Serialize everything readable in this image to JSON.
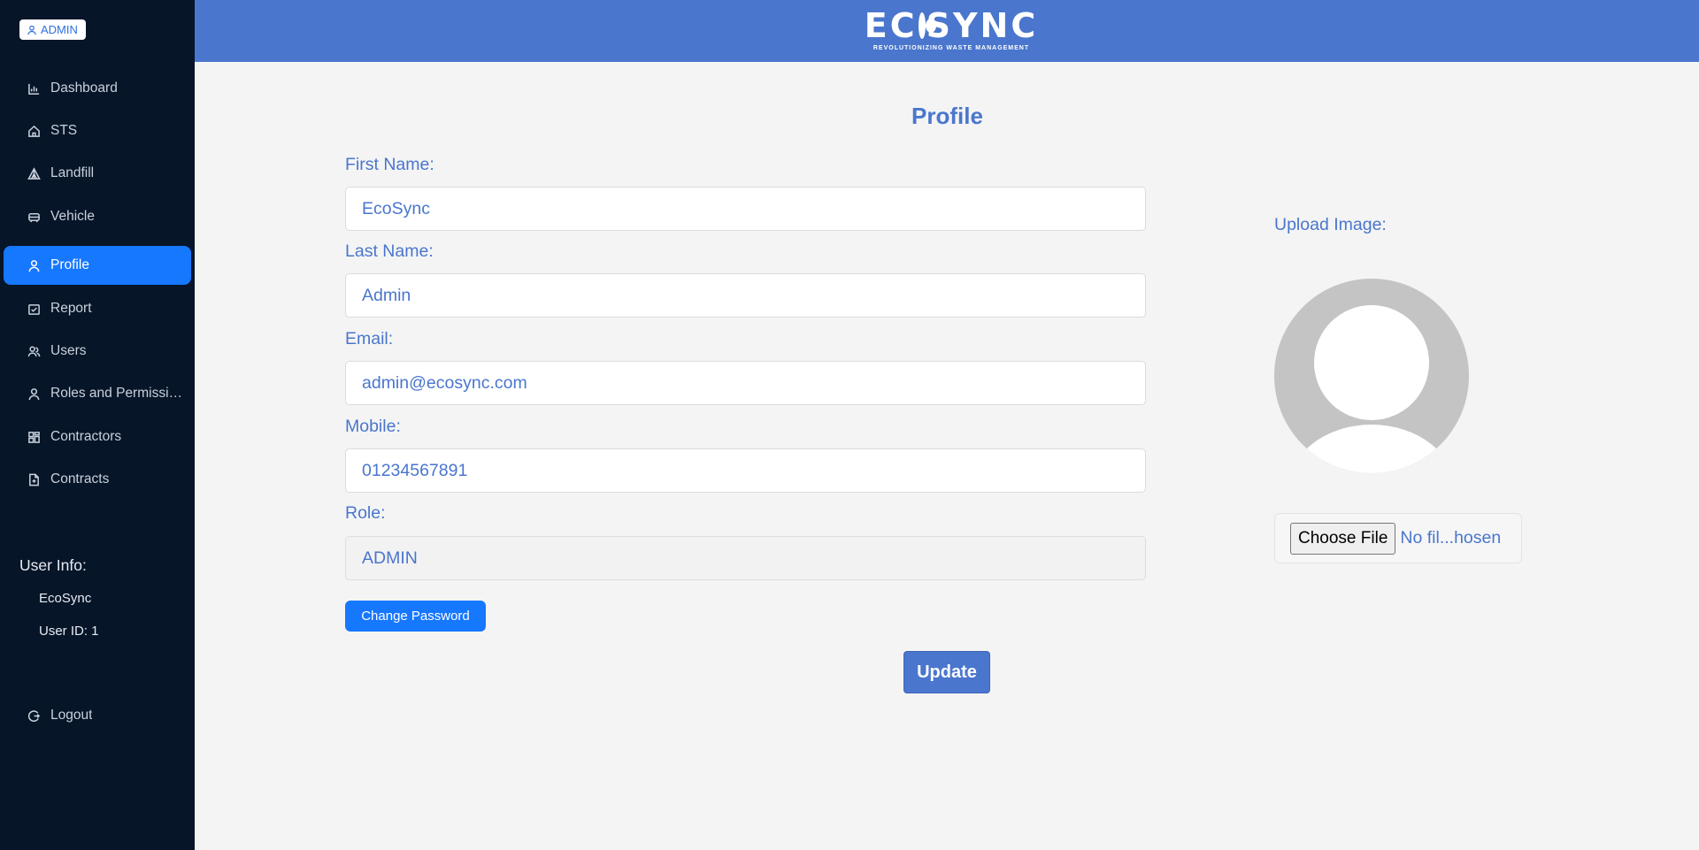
{
  "sidebar": {
    "role_badge": "ADMIN",
    "items": [
      {
        "label": "Dashboard",
        "icon": "bar-chart-icon"
      },
      {
        "label": "STS",
        "icon": "home-icon"
      },
      {
        "label": "Landfill",
        "icon": "triangle-icon"
      },
      {
        "label": "Vehicle",
        "icon": "car-icon"
      },
      {
        "label": "Profile",
        "icon": "user-icon",
        "active": true
      },
      {
        "label": "Report",
        "icon": "calendar-check-icon"
      },
      {
        "label": "Users",
        "icon": "users-icon"
      },
      {
        "label": "Roles and Permissions",
        "icon": "user-icon"
      },
      {
        "label": "Contractors",
        "icon": "grid-icon"
      },
      {
        "label": "Contracts",
        "icon": "file-icon"
      }
    ],
    "user_info": {
      "title": "User Info:",
      "name": "EcoSync",
      "user_id": "User ID: 1"
    },
    "logout_label": "Logout"
  },
  "header": {
    "logo_text_left": "EC",
    "logo_text_right": "SYNC",
    "logo_tagline": "REVOLUTIONIZING WASTE MANAGEMENT"
  },
  "main": {
    "title": "Profile",
    "fields": {
      "first_name": {
        "label": "First Name:",
        "value": "EcoSync"
      },
      "last_name": {
        "label": "Last Name:",
        "value": "Admin"
      },
      "email": {
        "label": "Email:",
        "value": "admin@ecosync.com"
      },
      "mobile": {
        "label": "Mobile:",
        "value": "01234567891"
      },
      "role": {
        "label": "Role:",
        "value": "ADMIN"
      }
    },
    "change_password_label": "Change Password",
    "update_label": "Update",
    "upload": {
      "label": "Upload Image:",
      "choose_file_label": "Choose File",
      "file_status": "No fil...hosen"
    }
  },
  "colors": {
    "accent": "#4a76cd",
    "primary_button": "#1677ff",
    "sidebar_bg": "#061528"
  }
}
